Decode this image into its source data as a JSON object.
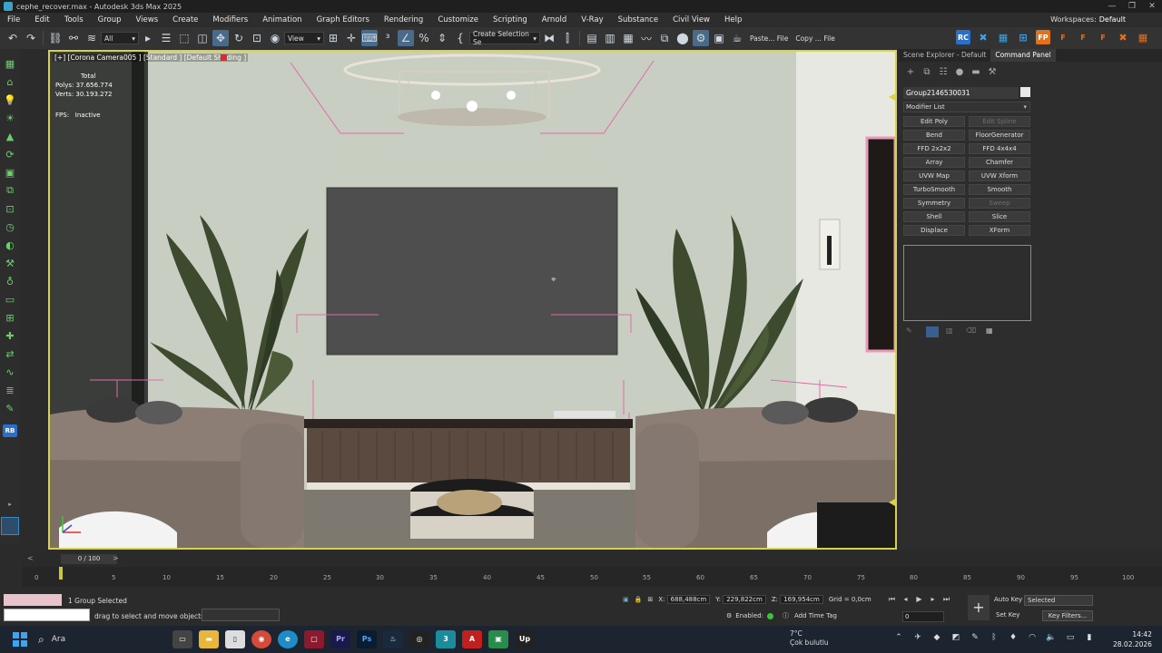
{
  "window": {
    "title": "cephe_recover.max - Autodesk 3ds Max 2025",
    "controls": [
      "—",
      "❐",
      "✕"
    ]
  },
  "menu": {
    "items": [
      "File",
      "Edit",
      "Tools",
      "Group",
      "Views",
      "Create",
      "Modifiers",
      "Animation",
      "Graph Editors",
      "Rendering",
      "Customize",
      "Scripting",
      "Arnold",
      "V-Ray",
      "Substance",
      "Civil View",
      "Help"
    ],
    "workspace_label": "Workspaces:",
    "workspace_value": "Default"
  },
  "toolbar": {
    "filter_value": "All",
    "view_value": "View",
    "selection_set": "Create Selection Se",
    "paste_label": "Paste...",
    "file1_label": "File",
    "copy_label": "Copy ...",
    "file2_label": "File",
    "right_buttons": [
      "RC",
      "FP"
    ]
  },
  "viewport": {
    "label": "[+] [Corona Camera005 ] [Standard ] [Default Shading ]",
    "stats": {
      "total_label": "Total",
      "polys_label": "Polys:",
      "polys_value": "37.656.774",
      "verts_label": "Verts:",
      "verts_value": "30.193.272",
      "fps_label": "FPS:",
      "fps_value": "Inactive"
    }
  },
  "right_panel": {
    "tabs": [
      "Scene Explorer - Default",
      "Command Panel"
    ],
    "object_name": "Group2146530031",
    "modifier_list": "Modifier List",
    "modifiers": [
      {
        "label": "Edit Poly",
        "enabled": true
      },
      {
        "label": "Edit Spline",
        "enabled": false
      },
      {
        "label": "Bend",
        "enabled": true
      },
      {
        "label": "FloorGenerator",
        "enabled": true
      },
      {
        "label": "FFD 2x2x2",
        "enabled": true
      },
      {
        "label": "FFD 4x4x4",
        "enabled": true
      },
      {
        "label": "Array",
        "enabled": true
      },
      {
        "label": "Chamfer",
        "enabled": true
      },
      {
        "label": "UVW Map",
        "enabled": true
      },
      {
        "label": "UVW Xform",
        "enabled": true
      },
      {
        "label": "TurboSmooth",
        "enabled": true
      },
      {
        "label": "Smooth",
        "enabled": true
      },
      {
        "label": "Symmetry",
        "enabled": true
      },
      {
        "label": "Sweep",
        "enabled": false
      },
      {
        "label": "Shell",
        "enabled": true
      },
      {
        "label": "Slice",
        "enabled": true
      },
      {
        "label": "Displace",
        "enabled": true
      },
      {
        "label": "XForm",
        "enabled": true
      }
    ]
  },
  "timeline": {
    "frame_range": "0 / 100",
    "ticks": [
      "0",
      "5",
      "10",
      "15",
      "20",
      "25",
      "30",
      "35",
      "40",
      "45",
      "50",
      "55",
      "60",
      "65",
      "70",
      "75",
      "80",
      "85",
      "90",
      "95",
      "100"
    ]
  },
  "status": {
    "selection_text": "1 Group Selected",
    "prompt_text": "drag to select and move objects",
    "x_label": "X:",
    "x_value": "688,488cm",
    "y_label": "Y:",
    "y_value": "229,822cm",
    "z_label": "Z:",
    "z_value": "169,954cm",
    "grid_label": "Grid = 0,0cm",
    "enabled_label": "Enabled:",
    "add_time_tag": "Add Time Tag",
    "current_frame": "0",
    "auto_key": "Auto Key",
    "set_key": "Set Key",
    "selected_dropdown": "Selected",
    "key_filters": "Key Filters..."
  },
  "taskbar": {
    "search_label": "Ara",
    "weather_temp": "7°C",
    "weather_desc": "Çok bulutlu",
    "time": "14:42",
    "date": "28.02.2026"
  },
  "colors": {
    "viewport_border": "#d8d14a",
    "accent": "#3aa3c8",
    "selection_pink": "#e06aa8"
  }
}
